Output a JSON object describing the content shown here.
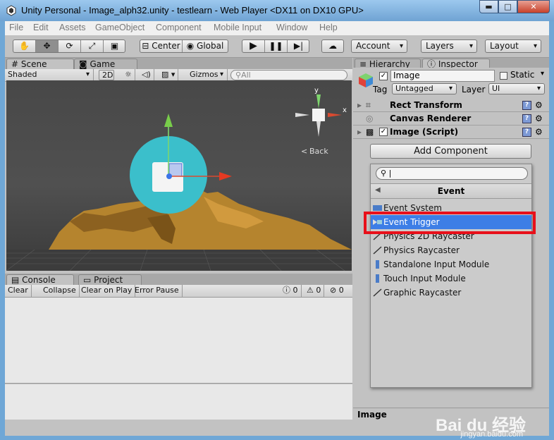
{
  "window": {
    "title": "Unity Personal - Image_alph32.unity - testlearn - Web Player <DX11 on DX10 GPU>",
    "min": "▬",
    "max": "□",
    "close": "✕"
  },
  "menu": [
    "File",
    "Edit",
    "Assets",
    "GameObject",
    "Component",
    "Mobile Input",
    "Window",
    "Help"
  ],
  "toolbar": {
    "center": "Center",
    "global": "Global",
    "account": "Account",
    "layers": "Layers",
    "layout": "Layout"
  },
  "scene_panel": {
    "tabs": [
      {
        "label": "Scene"
      },
      {
        "label": "Game"
      }
    ],
    "shading": "Shaded",
    "mode_2d": "2D",
    "gizmos": "Gizmos",
    "search_placeholder": "All",
    "back_label": "Back",
    "gizmo_y": "y",
    "gizmo_x": "x"
  },
  "console_panel": {
    "tabs": [
      {
        "label": "Console"
      },
      {
        "label": "Project"
      }
    ],
    "buttons": [
      "Clear",
      "Collapse",
      "Clear on Play",
      "Error Pause"
    ],
    "counts": {
      "info": "0",
      "warning": "0",
      "error": "0"
    }
  },
  "inspector_panel": {
    "tabs": [
      {
        "label": "Hierarchy"
      },
      {
        "label": "Inspector"
      }
    ],
    "object_name": "Image",
    "static_label": "Static",
    "tag_label": "Tag",
    "tag_value": "Untagged",
    "layer_label": "Layer",
    "layer_value": "UI",
    "components": [
      "Rect Transform",
      "Canvas Renderer",
      "Image (Script)"
    ],
    "add_component": "Add Component",
    "footer": "Image"
  },
  "popup": {
    "search_value": "",
    "header": "Event",
    "items": [
      "Event System",
      "Event Trigger",
      "Physics 2D Raycaster",
      "Physics Raycaster",
      "Standalone Input Module",
      "Touch Input Module",
      "Graphic Raycaster"
    ],
    "selected_index": 1
  },
  "watermark": {
    "brand": "Bai du 经验",
    "url": "jingyan.baidu.com"
  },
  "colors": {
    "selection": "#3d7ee6",
    "highlight_box": "#e8101a",
    "gizmo_circle": "#3bbfcb",
    "terrain": "#b5842e"
  }
}
